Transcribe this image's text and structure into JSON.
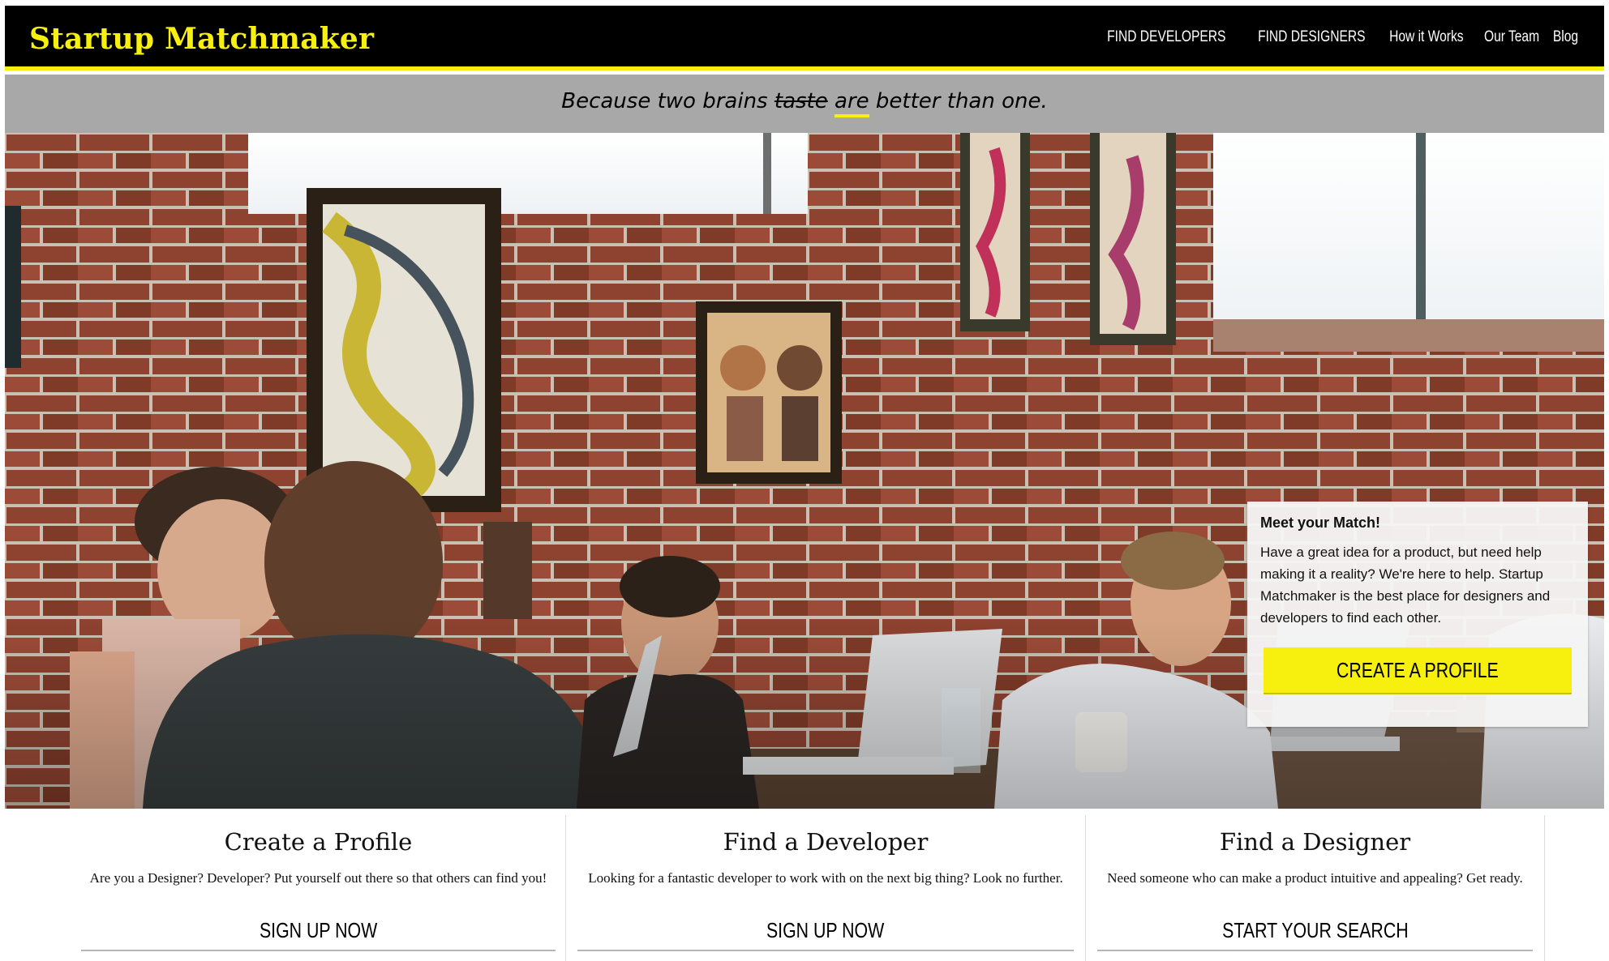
{
  "header": {
    "brand": "Startup Matchmaker",
    "nav": [
      "FIND DEVELOPERS",
      "FIND DESIGNERS",
      "How it Works",
      "Our Team",
      "Blog"
    ]
  },
  "tagline": {
    "before": "Because two brains ",
    "struck": "taste",
    "underlined": "are",
    "after": " better than one."
  },
  "hero": {
    "image_description_icon": "cafe-photo",
    "card": {
      "title": "Meet your Match!",
      "body": "Have a great idea for a product, but need help making it a reality? We're here to help. Startup Matchmaker is the best place for designers and developers to find each other.",
      "button_label": "CREATE A PROFILE"
    }
  },
  "features": [
    {
      "title": "Create a Profile",
      "text": "Are you a Designer? Developer? Put yourself out there so that others can find you!",
      "link": "SIGN UP NOW"
    },
    {
      "title": "Find a Developer",
      "text": "Looking for a fantastic developer to work with on the next big thing? Look no further.",
      "link": "SIGN UP NOW"
    },
    {
      "title": "Find a Designer",
      "text": "Need someone who can make a product intuitive and appealing? Get ready.",
      "link": "START YOUR SEARCH"
    }
  ],
  "colors": {
    "accent_yellow": "#f7f00f",
    "header_black": "#000000",
    "tagline_gray": "#a8a8a8",
    "brick": "#8e4230"
  }
}
